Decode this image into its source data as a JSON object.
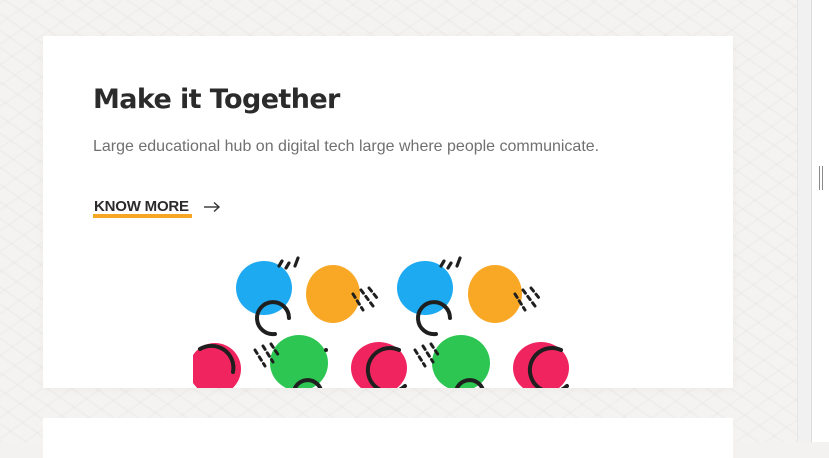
{
  "hero_card": {
    "title": "Make it Together",
    "description": "Large educational hub on digital tech large where people communicate.",
    "cta_label": "KNOW MORE",
    "cta_icon": "arrow-right-icon"
  },
  "colors": {
    "accent_underline": "#f5a623",
    "blob_blue": "#1eaaf1",
    "blob_orange": "#f9a826",
    "blob_green": "#2dc653",
    "blob_pink": "#f0245f"
  }
}
